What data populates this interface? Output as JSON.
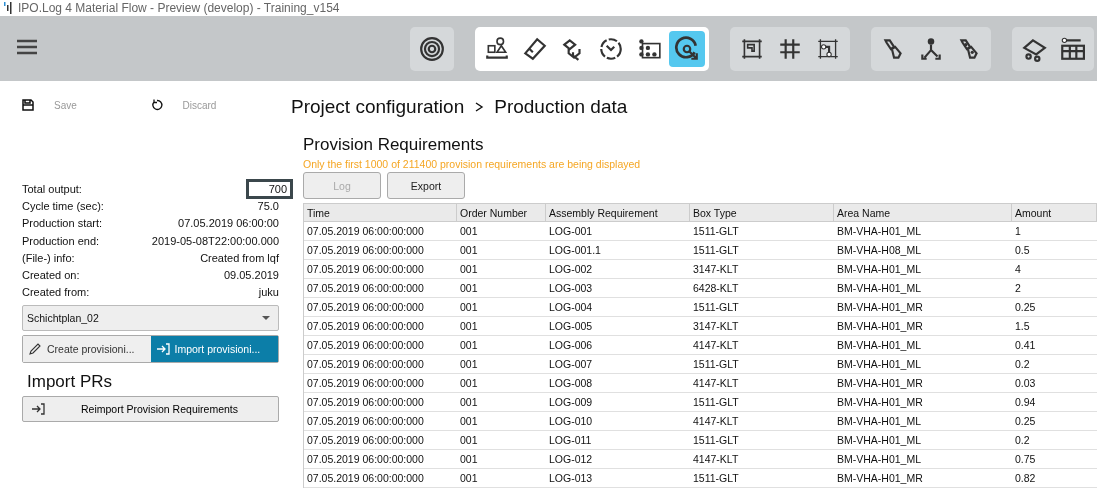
{
  "window": {
    "title": "IPO.Log 4 Material Flow - Preview (develop) - Training_v154"
  },
  "toolbar": {
    "groups": [
      {
        "tools": [
          {
            "selected": false
          }
        ]
      },
      {
        "tools": [
          {
            "selected": false
          },
          {
            "selected": false
          },
          {
            "selected": false
          },
          {
            "selected": false
          },
          {
            "selected": false
          },
          {
            "selected": true
          }
        ]
      },
      {
        "tools": [
          {
            "selected": false
          },
          {
            "selected": false
          },
          {
            "selected": false
          }
        ]
      },
      {
        "tools": [
          {
            "selected": false
          },
          {
            "selected": false
          },
          {
            "selected": false
          }
        ]
      },
      {
        "tools": [
          {
            "selected": false
          },
          {
            "selected": false
          }
        ]
      }
    ]
  },
  "actions": [
    {
      "label": "Save",
      "disabled": true
    },
    {
      "label": "Discard",
      "disabled": true
    }
  ],
  "breadcrumb": [
    "Project configuration",
    "Production data"
  ],
  "info_rows": [
    {
      "label": "Total output:",
      "value": "700",
      "kind": "field"
    },
    {
      "label": "Cycle time (sec):",
      "value": "75.0",
      "kind": "text"
    },
    {
      "label": "Production start:",
      "value": "07.05.2019 06:00:00",
      "kind": "text"
    },
    {
      "label": "Production end:",
      "value": "2019-05-08T22:00:00.000",
      "kind": "text"
    },
    {
      "label": "(File-) info:",
      "value": "Created from lqf",
      "kind": "text"
    },
    {
      "label": "Created on:",
      "value": "09.05.2019",
      "kind": "text"
    },
    {
      "label": "Created from:",
      "value": "juku",
      "kind": "text"
    }
  ],
  "shift_plan": {
    "value": "Schichtplan_02"
  },
  "mode_buttons": [
    {
      "label": "Create provisioni...",
      "selected": false
    },
    {
      "label": "Import provisioni...",
      "selected": true
    }
  ],
  "import_section": {
    "title": "Import PRs",
    "button": "Reimport Provision Requirements"
  },
  "provision": {
    "title": "Provision Requirements",
    "warning": "Only the first 1000 of 211400 provision requirements are being displayed",
    "buttons": [
      {
        "label": "Log",
        "disabled": true
      },
      {
        "label": "Export",
        "disabled": false
      }
    ]
  },
  "table": {
    "columns": [
      "Time",
      "Order Number",
      "Assembly Requirement",
      "Box Type",
      "Area Name",
      "Amount"
    ],
    "rows": [
      [
        "07.05.2019 06:00:00:000",
        "001",
        "LOG-001",
        "1511-GLT",
        "BM-VHA-H01_ML",
        "1"
      ],
      [
        "07.05.2019 06:00:00:000",
        "001",
        "LOG-001.1",
        "1511-GLT",
        "BM-VHA-H08_ML",
        "0.5"
      ],
      [
        "07.05.2019 06:00:00:000",
        "001",
        "LOG-002",
        "3147-KLT",
        "BM-VHA-H01_ML",
        "4"
      ],
      [
        "07.05.2019 06:00:00:000",
        "001",
        "LOG-003",
        "6428-KLT",
        "BM-VHA-H01_ML",
        "2"
      ],
      [
        "07.05.2019 06:00:00:000",
        "001",
        "LOG-004",
        "1511-GLT",
        "BM-VHA-H01_MR",
        "0.25"
      ],
      [
        "07.05.2019 06:00:00:000",
        "001",
        "LOG-005",
        "3147-KLT",
        "BM-VHA-H01_MR",
        "1.5"
      ],
      [
        "07.05.2019 06:00:00:000",
        "001",
        "LOG-006",
        "4147-KLT",
        "BM-VHA-H01_ML",
        "0.41"
      ],
      [
        "07.05.2019 06:00:00:000",
        "001",
        "LOG-007",
        "1511-GLT",
        "BM-VHA-H01_ML",
        "0.2"
      ],
      [
        "07.05.2019 06:00:00:000",
        "001",
        "LOG-008",
        "4147-KLT",
        "BM-VHA-H01_MR",
        "0.03"
      ],
      [
        "07.05.2019 06:00:00:000",
        "001",
        "LOG-009",
        "1511-GLT",
        "BM-VHA-H01_MR",
        "0.94"
      ],
      [
        "07.05.2019 06:00:00:000",
        "001",
        "LOG-010",
        "4147-KLT",
        "BM-VHA-H01_ML",
        "0.25"
      ],
      [
        "07.05.2019 06:00:00:000",
        "001",
        "LOG-011",
        "1511-GLT",
        "BM-VHA-H01_ML",
        "0.2"
      ],
      [
        "07.05.2019 06:00:00:000",
        "001",
        "LOG-012",
        "4147-KLT",
        "BM-VHA-H01_ML",
        "0.75"
      ],
      [
        "07.05.2019 06:00:00:000",
        "001",
        "LOG-013",
        "1511-GLT",
        "BM-VHA-H01_MR",
        "0.82"
      ]
    ]
  }
}
